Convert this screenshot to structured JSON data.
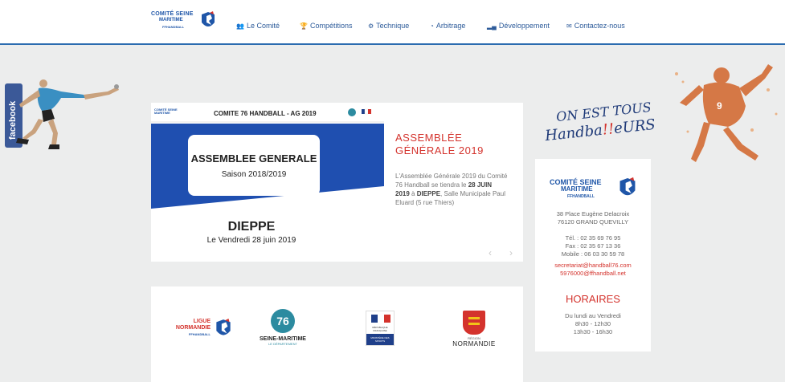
{
  "header": {
    "logo_line1": "COMITÉ SEINE",
    "logo_line2": "MARITIME",
    "logo_line3": "FFHANDBALL",
    "nav": [
      {
        "label": "Le Comité",
        "icon": "users-icon"
      },
      {
        "label": "Compétitions",
        "icon": "trophy-icon"
      },
      {
        "label": "Technique",
        "icon": "cogs-icon"
      },
      {
        "label": "Arbitrage",
        "icon": "whistle-icon"
      },
      {
        "label": "Développement",
        "icon": "bar-chart-icon"
      },
      {
        "label": "Contactez-nous",
        "icon": "envelope-icon"
      }
    ]
  },
  "facebook": {
    "label": "facebook"
  },
  "slide": {
    "poster_header": "COMITE 76 HANDBALL - AG 2019",
    "poster_logo": "COMITÉ SEINE MARITIME",
    "box_title": "ASSEMBLEE GENERALE",
    "box_subtitle": "Saison 2018/2019",
    "city": "DIEPPE",
    "date": "Le Vendredi 28 juin 2019",
    "title": "ASSEMBLÉE GÉNÉRALE 2019",
    "text_before": "L'Assemblée Générale 2019 du Comité 76 Handball se tiendra le ",
    "text_bold1": "28 JUIN 2019",
    "text_mid": " à ",
    "text_bold2": "DIEPPE",
    "text_after": ", Salle Municipale Paul Eluard (5 rue Thiers)",
    "prev": "‹",
    "next": "›"
  },
  "partners": {
    "ligue_line1": "LIGUE",
    "ligue_line2": "NORMANDIE",
    "ligue_line3": "FFHANDBALL",
    "sm_number": "76",
    "sm_name": "SEINE-MARITIME",
    "sm_sub": "LE DÉPARTEMENT",
    "rep_line1": "RÉPUBLIQUE FRANÇAISE",
    "rep_line2": "MINISTÈRE DES SPORTS",
    "norm_line1": "RÉGION",
    "norm_line2": "NORMANDIE"
  },
  "sidebar": {
    "slogan_line1": "ON EST TOUS",
    "slogan_line2a": "Handba",
    "slogan_line2b": "!!",
    "slogan_line2c": "eURS",
    "logo_line1": "COMITÉ SEINE",
    "logo_line2": "MARITIME",
    "logo_line3": "FFHANDBALL",
    "address1": "38 Place Eugène Delacroix",
    "address2": "76120 GRAND QUEVILLY",
    "tel": "Tél. : 02 35 69 76 95",
    "fax": "Fax : 02 35 67 13 36",
    "mobile": "Mobile : 06 03 30 59 78",
    "email1": "secretariat@handball76.com",
    "email2": "5976000@ffhandball.net",
    "hours_title": "HORAIRES",
    "hours1": "Du lundi au Vendredi",
    "hours2": "8h30 - 12h30",
    "hours3": "13h30 - 16h30"
  },
  "colors": {
    "accent": "#2b6cb0",
    "brand_red": "#d4332d",
    "brand_blue": "#1f56a8"
  }
}
